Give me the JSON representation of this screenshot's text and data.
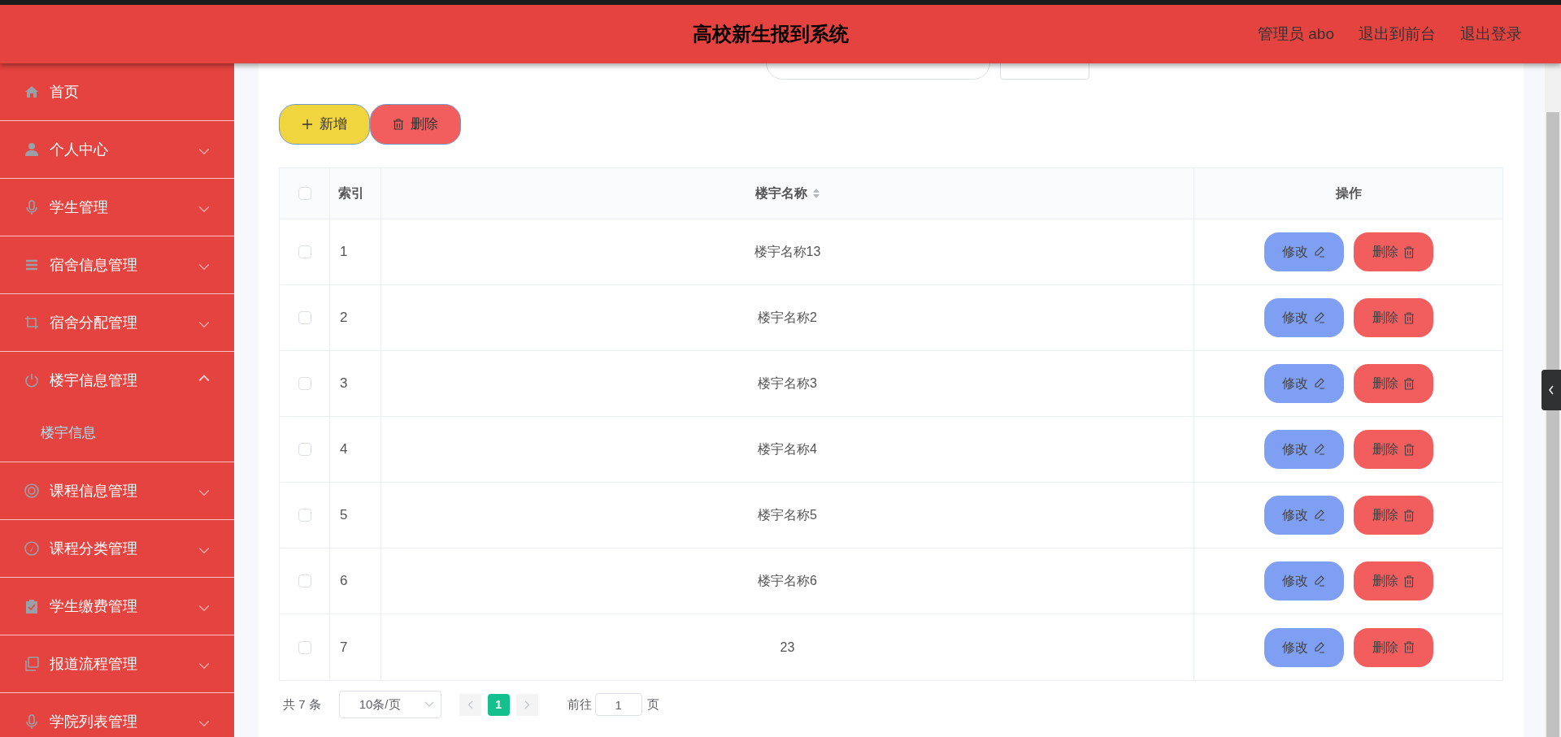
{
  "header": {
    "title": "高校新生报到系统",
    "links": [
      "管理员 abo",
      "退出到前台",
      "退出登录"
    ]
  },
  "sidebar": {
    "items": [
      {
        "label": "首页"
      },
      {
        "label": "个人中心",
        "expanded": false
      },
      {
        "label": "学生管理",
        "expanded": false
      },
      {
        "label": "宿舍信息管理",
        "expanded": false
      },
      {
        "label": "宿舍分配管理",
        "expanded": false
      },
      {
        "label": "楼宇信息管理",
        "expanded": true,
        "children": [
          {
            "label": "楼宇信息",
            "selected": true
          }
        ]
      },
      {
        "label": "课程信息管理",
        "expanded": false
      },
      {
        "label": "课程分类管理",
        "expanded": false
      },
      {
        "label": "学生缴费管理",
        "expanded": false
      },
      {
        "label": "报道流程管理",
        "expanded": false
      },
      {
        "label": "学院列表管理",
        "expanded": false
      }
    ]
  },
  "toolbar": [
    {
      "label": "新增",
      "kind": "add"
    },
    {
      "label": "删除",
      "kind": "delete"
    }
  ],
  "table": {
    "all_checked": false,
    "columns": [
      "索引",
      "楼宇名称",
      "操作"
    ],
    "rows": [
      {
        "checked": false,
        "index": "1",
        "name": "楼宇名称13",
        "actions": [
          "修改",
          "删除"
        ]
      },
      {
        "checked": false,
        "index": "2",
        "name": "楼宇名称2",
        "actions": [
          "修改",
          "删除"
        ]
      },
      {
        "checked": false,
        "index": "3",
        "name": "楼宇名称3",
        "actions": [
          "修改",
          "删除"
        ]
      },
      {
        "checked": false,
        "index": "4",
        "name": "楼宇名称4",
        "actions": [
          "修改",
          "删除"
        ]
      },
      {
        "checked": false,
        "index": "5",
        "name": "楼宇名称5",
        "actions": [
          "修改",
          "删除"
        ]
      },
      {
        "checked": false,
        "index": "6",
        "name": "楼宇名称6",
        "actions": [
          "修改",
          "删除"
        ]
      },
      {
        "checked": false,
        "index": "7",
        "name": "23",
        "actions": [
          "修改",
          "删除"
        ]
      }
    ]
  },
  "pagination": {
    "total": "共 7 条",
    "page_size": "10条/页",
    "pages": [
      {
        "label": "1",
        "selected": true
      }
    ],
    "goto_label": "前往",
    "goto_value": "1",
    "goto_suffix": "页"
  }
}
